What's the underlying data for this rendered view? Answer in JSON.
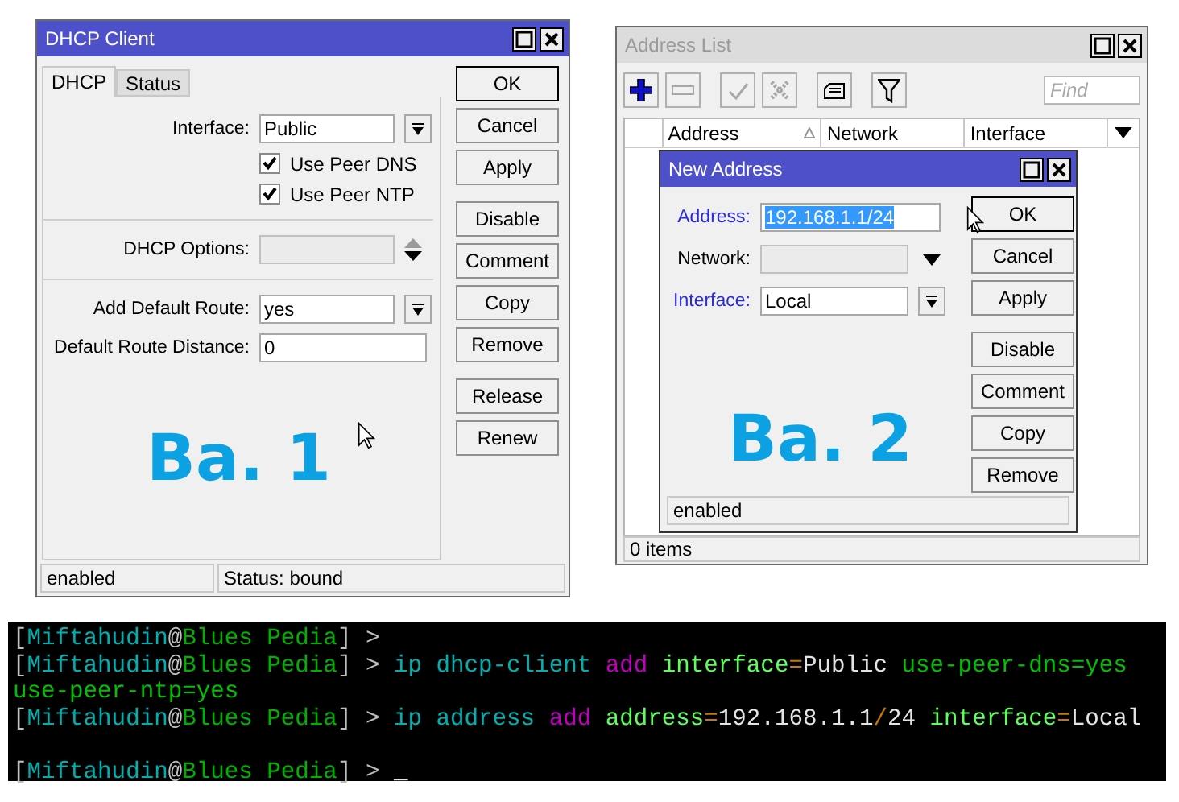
{
  "dhcp_client_window": {
    "title": "DHCP Client",
    "active": true,
    "tabs": [
      {
        "label": "DHCP",
        "selected": true
      },
      {
        "label": "Status",
        "selected": false
      }
    ],
    "fields": [
      {
        "kind": "select",
        "label": "Interface:",
        "value": "Public"
      },
      {
        "kind": "checkbox",
        "label": "Use Peer DNS",
        "checked": true
      },
      {
        "kind": "checkbox",
        "label": "Use Peer NTP",
        "checked": true
      },
      {
        "kind": "separator"
      },
      {
        "kind": "spinner",
        "label": "DHCP Options:",
        "disabled": true
      },
      {
        "kind": "separator"
      },
      {
        "kind": "select",
        "label": "Add Default Route:",
        "value": "yes"
      },
      {
        "kind": "text",
        "label": "Default Route Distance:",
        "value": "0"
      }
    ],
    "button_groups": [
      [
        {
          "label": "OK",
          "default": true
        },
        {
          "label": "Cancel",
          "default": false
        },
        {
          "label": "Apply",
          "default": false
        }
      ],
      [
        {
          "label": "Disable",
          "default": false
        },
        {
          "label": "Comment",
          "default": false
        },
        {
          "label": "Copy",
          "default": false
        },
        {
          "label": "Remove",
          "default": false
        }
      ],
      [
        {
          "label": "Release",
          "default": false
        },
        {
          "label": "Renew",
          "default": false
        }
      ]
    ],
    "caption": "Ba. 1",
    "status_bar": [
      "enabled",
      "Status: bound"
    ]
  },
  "address_list_window": {
    "title": "Address List",
    "active": false,
    "toolbar": [
      {
        "kind": "add",
        "disabled": false
      },
      {
        "kind": "remove",
        "disabled": true
      },
      {
        "kind": "enable",
        "disabled": true
      },
      {
        "kind": "disable",
        "disabled": true
      },
      {
        "kind": "comment",
        "disabled": false
      },
      {
        "kind": "filter",
        "disabled": false
      }
    ],
    "find_placeholder": "Find",
    "columns": [
      {
        "label": "Address",
        "sorted": true
      },
      {
        "label": "Network",
        "sorted": false
      },
      {
        "label": "Interface",
        "sorted": false
      }
    ],
    "status": "0 items",
    "new_address_dialog": {
      "title": "New Address",
      "active": true,
      "fields": [
        {
          "kind": "text",
          "label": "Address:",
          "value": "192.168.1.1/24",
          "emphasized": true,
          "highlighted": true
        },
        {
          "kind": "combo",
          "label": "Network:",
          "emphasized": false,
          "disabled": true
        },
        {
          "kind": "select",
          "label": "Interface:",
          "value": "Local",
          "emphasized": true
        }
      ],
      "button_groups": [
        [
          {
            "label": "OK",
            "default": true
          },
          {
            "label": "Cancel",
            "default": false
          },
          {
            "label": "Apply",
            "default": false
          }
        ],
        [
          {
            "label": "Disable",
            "default": false
          },
          {
            "label": "Comment",
            "default": false
          },
          {
            "label": "Copy",
            "default": false
          },
          {
            "label": "Remove",
            "default": false
          }
        ]
      ],
      "caption": "Ba. 2",
      "status": "enabled"
    }
  },
  "terminal": {
    "lines": [
      {
        "segments": [
          {
            "kind": "punct",
            "text": "["
          },
          {
            "kind": "user",
            "text": "Miftahudin"
          },
          {
            "kind": "punct",
            "text": "@"
          },
          {
            "kind": "host",
            "text": "Blues Pedia"
          },
          {
            "kind": "punct",
            "text": "] >"
          }
        ]
      },
      {
        "segments": [
          {
            "kind": "punct",
            "text": "["
          },
          {
            "kind": "user",
            "text": "Miftahudin"
          },
          {
            "kind": "punct",
            "text": "@"
          },
          {
            "kind": "host",
            "text": "Blues Pedia"
          },
          {
            "kind": "punct",
            "text": "] > "
          },
          {
            "kind": "cmd",
            "text": "ip dhcp-client"
          },
          {
            "kind": "verb",
            "text": " add"
          },
          {
            "kind": "key",
            "text": " interface"
          },
          {
            "kind": "op",
            "text": "="
          },
          {
            "kind": "val",
            "text": "Public"
          },
          {
            "kind": "arg",
            "text": " use-peer-dns=yes"
          }
        ]
      },
      {
        "segments": [
          {
            "kind": "arg",
            "text": "use-peer-ntp=yes"
          }
        ]
      },
      {
        "segments": [
          {
            "kind": "punct",
            "text": "["
          },
          {
            "kind": "user",
            "text": "Miftahudin"
          },
          {
            "kind": "punct",
            "text": "@"
          },
          {
            "kind": "host",
            "text": "Blues Pedia"
          },
          {
            "kind": "punct",
            "text": "] > "
          },
          {
            "kind": "cmd",
            "text": "ip address"
          },
          {
            "kind": "verb",
            "text": " add"
          },
          {
            "kind": "key",
            "text": " address"
          },
          {
            "kind": "op",
            "text": "="
          },
          {
            "kind": "val",
            "text": "192.168.1.1"
          },
          {
            "kind": "op",
            "text": "/"
          },
          {
            "kind": "val",
            "text": "24"
          },
          {
            "kind": "key",
            "text": " interface"
          },
          {
            "kind": "op",
            "text": "="
          },
          {
            "kind": "val",
            "text": "Local"
          }
        ]
      },
      {
        "blank_before": true,
        "segments": [
          {
            "kind": "punct",
            "text": "["
          },
          {
            "kind": "user",
            "text": "Miftahudin"
          },
          {
            "kind": "punct",
            "text": "@"
          },
          {
            "kind": "host",
            "text": "Blues Pedia"
          },
          {
            "kind": "punct",
            "text": "] > "
          },
          {
            "kind": "cursor",
            "text": "_"
          }
        ]
      }
    ]
  }
}
